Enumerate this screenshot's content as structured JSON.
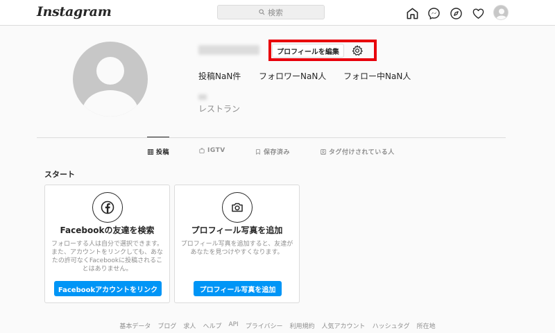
{
  "header": {
    "logo": "Instagram",
    "search_placeholder": "検索"
  },
  "profile": {
    "username": "instaprofile",
    "edit_button": "プロフィールを編集",
    "stats": {
      "posts": "投稿NaN件",
      "followers": "フォロワーNaN人",
      "following": "フォロー中NaN人"
    },
    "fullname": "ab",
    "category": "レストラン"
  },
  "tabs": [
    {
      "label": "投稿"
    },
    {
      "label": "IGTV"
    },
    {
      "label": "保存済み"
    },
    {
      "label": "タグ付けされている人"
    }
  ],
  "start_title": "スタート",
  "cards": [
    {
      "title": "Facebookの友達を検索",
      "desc": "フォローする人は自分で選択できます。また、アカウントをリンクしても、あなたの許可なくFacebookに投稿されることはありません。",
      "button": "Facebookアカウントをリンク"
    },
    {
      "title": "プロフィール写真を追加",
      "desc": "プロフィール写真を追加すると、友達があなたを見つけやすくなります。",
      "button": "プロフィール写真を追加"
    }
  ],
  "footer": [
    "基本データ",
    "ブログ",
    "求人",
    "ヘルプ",
    "API",
    "プライバシー",
    "利用規約",
    "人気アカウント",
    "ハッシュタグ",
    "所在地"
  ],
  "colors": {
    "accent": "#0095f6",
    "highlight": "#e8000b"
  }
}
